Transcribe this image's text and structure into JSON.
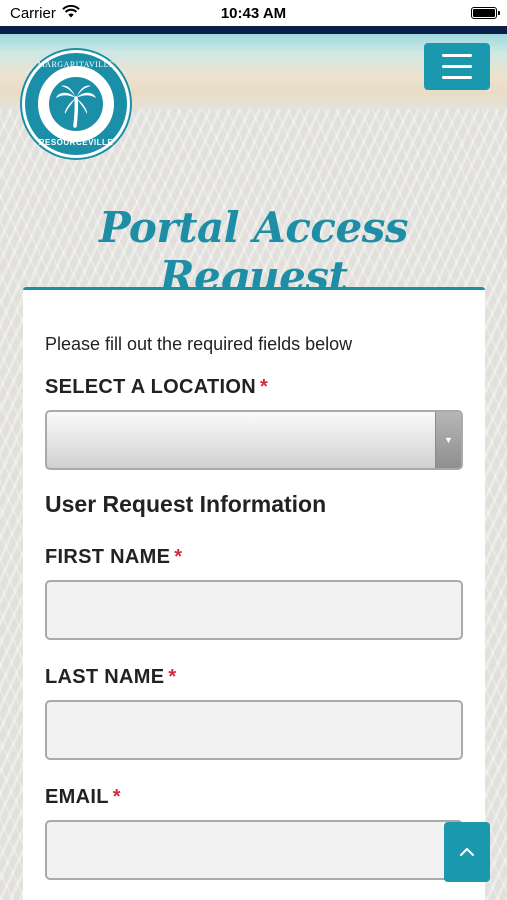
{
  "status_bar": {
    "carrier": "Carrier",
    "time": "10:43 AM"
  },
  "logo": {
    "top_text": "MARGARITAVILLE",
    "bottom_text": "RESOURCEVILLE"
  },
  "header": {
    "title": "Portal Access Request"
  },
  "form": {
    "intro": "Please fill out the required fields below",
    "location_label": "SELECT A LOCATION",
    "location_value": "",
    "section_heading": "User Request Information",
    "first_name_label": "FIRST NAME",
    "last_name_label": "LAST NAME",
    "email_label": "EMAIL",
    "required_marker": "*"
  },
  "colors": {
    "accent": "#1a98ad",
    "required": "#d22b3a",
    "status_stripe": "#0c1e46"
  },
  "icons": {
    "wifi": "wifi-icon",
    "battery": "battery-icon",
    "menu": "hamburger-icon",
    "dropdown": "chevron-down-icon",
    "scroll_top": "chevron-up-icon"
  }
}
